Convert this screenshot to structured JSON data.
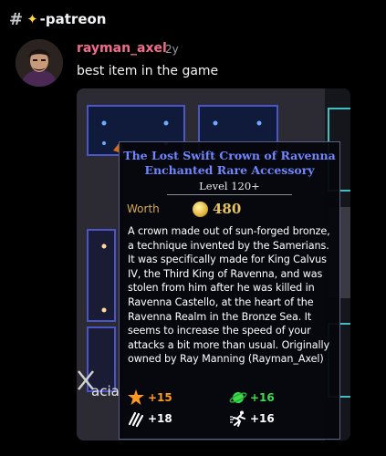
{
  "channel": {
    "name": "-patreon"
  },
  "message": {
    "author": "rayman_axel",
    "timestamp": "2y",
    "text": "best item in the game"
  },
  "tooltip": {
    "title_line1": "The Lost Swift Crown of Ravenna",
    "title_line2": "Enchanted Rare Accessory",
    "level": "Level 120+",
    "worth_label": "Worth",
    "worth_value": "480",
    "description": "A crown made out of sun-forged bronze, a technique invented by the Samerians. It was specifically made for King Calvus IV, the Third King of Ravenna, and was stolen from him after he was killed in Ravenna Castello, at the heart of the Ravenna Realm in the Bronze Sea. It seems to increase the speed of your attacks a bit more than usual. Originally owned by Ray Manning (Rayman_Axel)",
    "stats": [
      {
        "icon": "star-burst-icon",
        "value": "+15",
        "color": "#ff9a1f"
      },
      {
        "icon": "planet-icon",
        "value": "+16",
        "color": "#3ddc4a"
      },
      {
        "icon": "swift-attack-icon",
        "value": "+18",
        "color": "#ffffff"
      },
      {
        "icon": "running-figure-icon",
        "value": "+16",
        "color": "#ffffff"
      }
    ]
  },
  "background": {
    "partial_text": "acia"
  },
  "colors": {
    "username": "#f26b8a",
    "title_blue": "#6f86ff",
    "worth_gold": "#d8a74b"
  }
}
